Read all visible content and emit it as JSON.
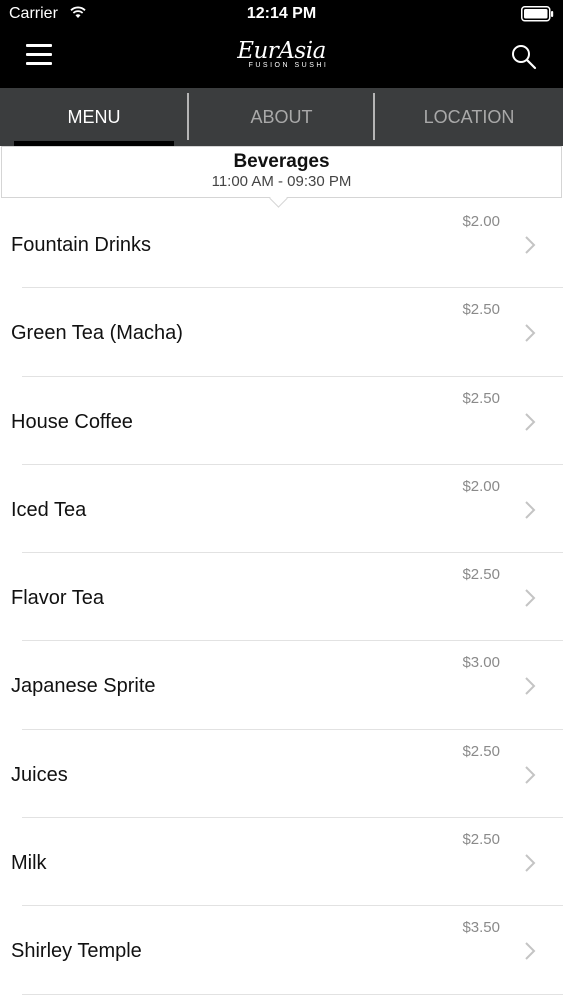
{
  "status_bar": {
    "carrier": "Carrier",
    "time": "12:14 PM"
  },
  "header": {
    "logo_main": "EurAsia",
    "logo_sub": "FUSION SUSHI",
    "icons": [
      "hamburger-menu-icon",
      "search-icon"
    ]
  },
  "tabs": [
    {
      "label": "MENU",
      "active": true
    },
    {
      "label": "ABOUT",
      "active": false
    },
    {
      "label": "LOCATION",
      "active": false
    }
  ],
  "section": {
    "title": "Beverages",
    "hours": "11:00 AM - 09:30 PM"
  },
  "items": [
    {
      "name": "Fountain Drinks",
      "price": "$2.00"
    },
    {
      "name": "Green Tea (Macha)",
      "price": "$2.50"
    },
    {
      "name": "House Coffee",
      "price": "$2.50"
    },
    {
      "name": "Iced Tea",
      "price": "$2.00"
    },
    {
      "name": "Flavor Tea",
      "price": "$2.50"
    },
    {
      "name": "Japanese Sprite",
      "price": "$3.00"
    },
    {
      "name": "Juices",
      "price": "$2.50"
    },
    {
      "name": "Milk",
      "price": "$2.50"
    },
    {
      "name": "Shirley Temple",
      "price": "$3.50"
    }
  ],
  "colors": {
    "header_bg": "#000000",
    "tab_bar_bg": "#3b3d3e",
    "active_tab_text": "#ffffff",
    "inactive_tab_text": "#a9a9a9",
    "price_text": "#8a8a8a"
  }
}
